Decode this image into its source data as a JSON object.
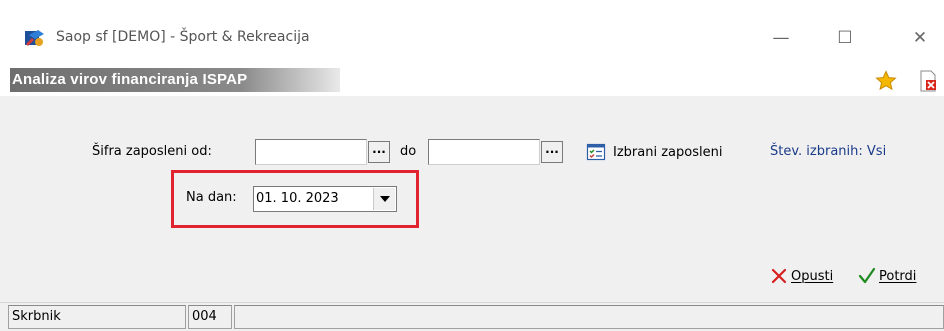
{
  "window": {
    "title": "Saop sf [DEMO] - Šport & Rekreacija",
    "minimize_glyph": "—",
    "maximize_glyph": "☐",
    "close_glyph": "✕"
  },
  "header": {
    "title": "Analiza virov financiranja ISPAP",
    "icons": [
      "star-icon",
      "close-document-icon"
    ]
  },
  "form": {
    "employee_from_label": "Šifra zaposleni od:",
    "employee_from_value": "",
    "ellipsis_label": "...",
    "to_label": "do",
    "employee_to_value": "",
    "selected_employees_label": "Izbrani zaposleni",
    "selected_count_label": "Štev. izbranih: Vsi",
    "date_label": "Na dan:",
    "date_value": "01. 10. 2023"
  },
  "actions": {
    "cancel_label": "Opusti",
    "confirm_label": "Potrdi"
  },
  "statusbar": {
    "cell1": "Skrbnik",
    "cell2": "004",
    "cell3": ""
  },
  "colors": {
    "highlight": "#e1222f",
    "header_bg": "#7a7a7a",
    "cancel_icon": "#d81e1e",
    "confirm_icon": "#1e8a1e",
    "selected_count_text": "#1a3a8a"
  }
}
